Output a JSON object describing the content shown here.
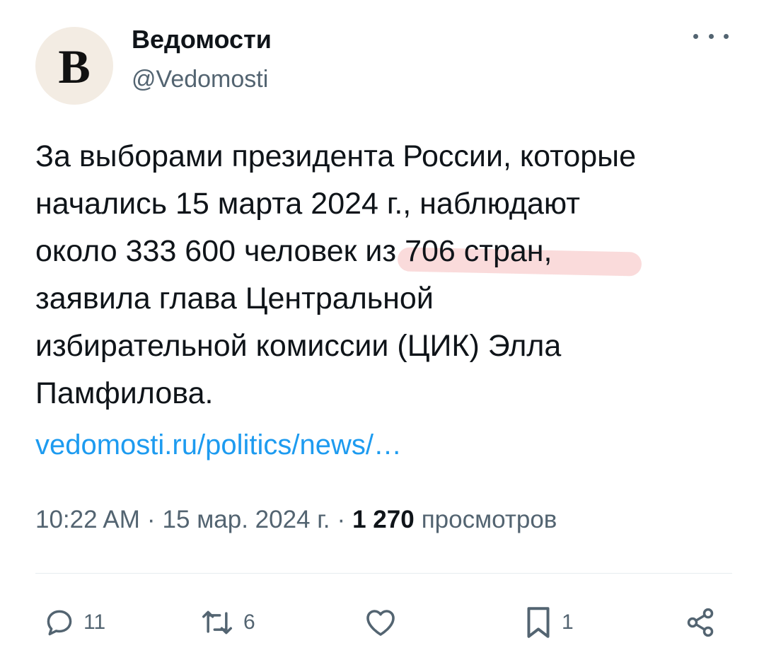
{
  "author": {
    "avatar_letter": "В",
    "name": "Ведомости",
    "handle": "@Vedomosti"
  },
  "tweet": {
    "lines": [
      "За выборами президента России, которые",
      "начались 15 марта 2024 г., наблюдают",
      "около 333 600 человек из 706 стран,",
      "заявила глава Центральной",
      "избирательной комиссии (ЦИК) Элла",
      "Памфилова."
    ],
    "link": "vedomosti.ru/politics/news/…"
  },
  "meta": {
    "time": "10:22 AM",
    "sep1": "·",
    "date": "15 мар. 2024 г.",
    "sep2": "·",
    "views_count": "1 270",
    "views_label": "просмотров"
  },
  "actions": {
    "replies": "11",
    "retweets": "6",
    "likes": "",
    "bookmarks": "1"
  },
  "colors": {
    "link": "#1d9bf0",
    "secondary_text": "#536471",
    "highlight_marker": "#f4aaaa"
  },
  "icons": [
    "more-icon",
    "reply-icon",
    "retweet-icon",
    "like-icon",
    "bookmark-icon",
    "share-icon"
  ]
}
